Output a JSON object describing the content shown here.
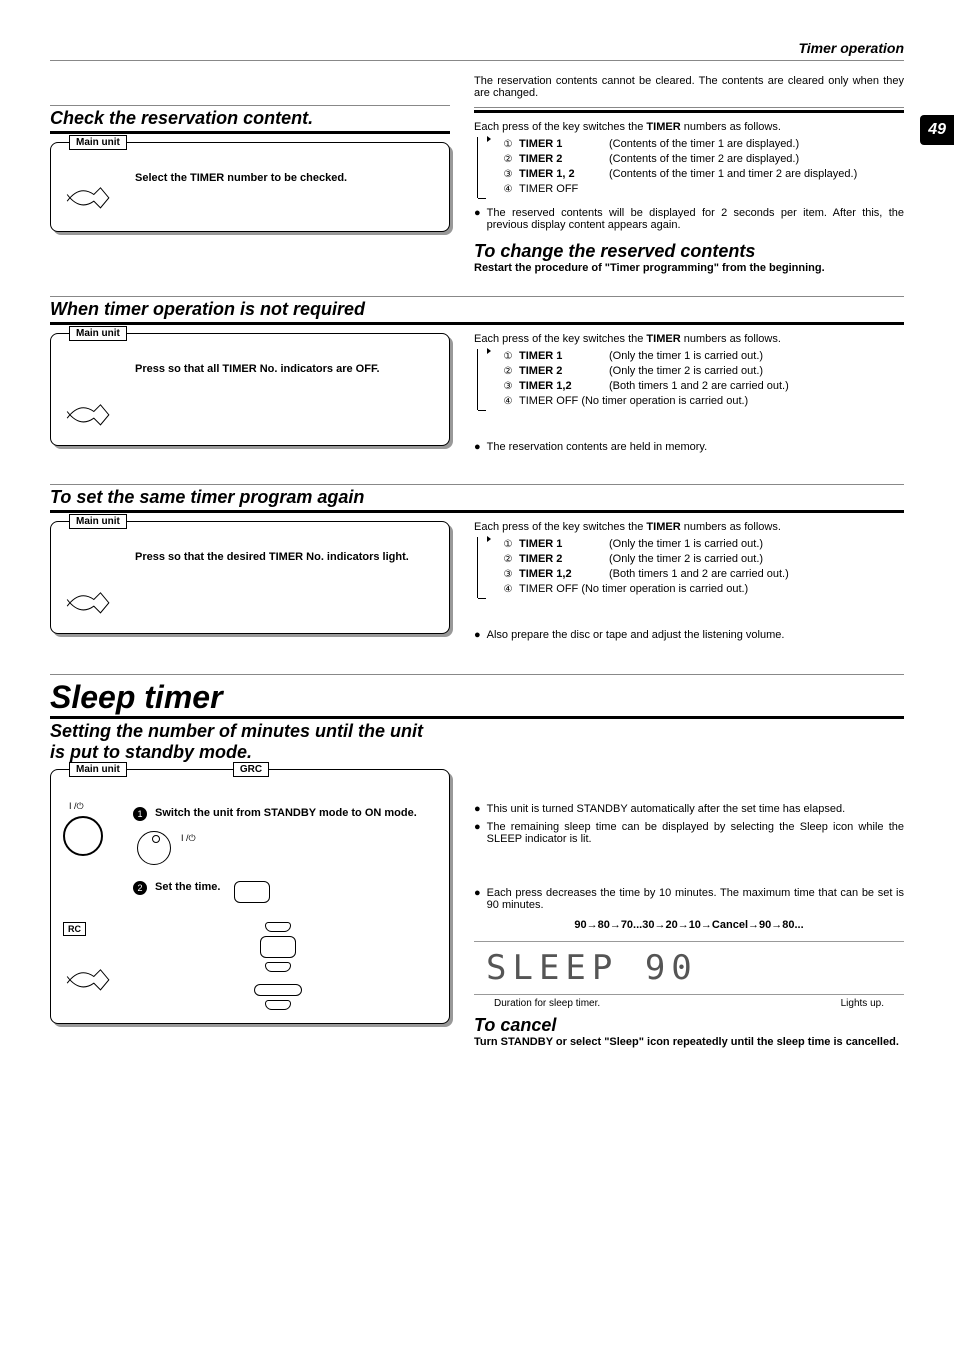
{
  "header": {
    "breadcrumb": "Timer operation",
    "page_number": "49"
  },
  "section1": {
    "title": "Check the reservation content.",
    "box_label": "Main unit",
    "step_text": "Select the TIMER number to be checked.",
    "intro": "The reservation contents cannot be cleared. The contents are cleared only when they are changed.",
    "each_press": "Each press of the key switches the ",
    "each_press_bold": "TIMER",
    "each_press_tail": " numbers as follows.",
    "list": [
      {
        "n": "①",
        "b": "TIMER 1",
        "t": "(Contents of the timer 1 are displayed.)"
      },
      {
        "n": "②",
        "b": "TIMER 2",
        "t": "(Contents of the timer 2 are displayed.)"
      },
      {
        "n": "③",
        "b": "TIMER 1, 2",
        "t": "(Contents of the timer 1 and timer 2 are displayed.)"
      },
      {
        "n": "④",
        "b": "",
        "t": "TIMER OFF"
      }
    ],
    "note": "The reserved contents will be displayed for 2 seconds per item. After this, the previous display content appears again.",
    "subheading": "To change the reserved contents",
    "subtext": "Restart the procedure of \"Timer programming\" from the beginning."
  },
  "section2": {
    "title": "When timer operation is not required",
    "box_label": "Main unit",
    "step_text": "Press so that all TIMER No. indicators are OFF.",
    "list": [
      {
        "n": "①",
        "b": "TIMER 1",
        "t": "(Only the timer 1 is carried out.)"
      },
      {
        "n": "②",
        "b": "TIMER 2",
        "t": "(Only the timer 2 is carried out.)"
      },
      {
        "n": "③",
        "b": "TIMER 1,2",
        "t": "(Both timers 1 and 2 are carried out.)"
      },
      {
        "n": "④",
        "b": "",
        "t": "TIMER OFF  (No timer operation is carried out.)"
      }
    ],
    "note": "The reservation contents are held in memory."
  },
  "section3": {
    "title": "To set the same timer program again",
    "box_label": "Main unit",
    "step_text": "Press so that the desired TIMER No. indicators light.",
    "list": [
      {
        "n": "①",
        "b": "TIMER 1",
        "t": "(Only the timer 1 is carried out.)"
      },
      {
        "n": "②",
        "b": "TIMER 2",
        "t": "(Only the timer 2 is carried out.)"
      },
      {
        "n": "③",
        "b": "TIMER 1,2",
        "t": "(Both timers 1 and 2 are carried out.)"
      },
      {
        "n": "④",
        "b": "",
        "t": "TIMER OFF  (No timer operation is carried out.)"
      }
    ],
    "note": "Also prepare the disc or tape and adjust the listening volume."
  },
  "sleep": {
    "title": "Sleep timer",
    "subtitle1": "Setting the number of minutes until the unit",
    "subtitle2": "is put to standby mode.",
    "box_label1": "Main unit",
    "box_label2": "GRC",
    "box_label3": "RC",
    "step1": "Switch the unit from STANDBY mode to ON mode.",
    "step2": "Set the time.",
    "power_label": "I /⏻",
    "power_label2": "I /⏻",
    "bullet1": "This unit is turned STANDBY automatically after the set time has elapsed.",
    "bullet2": "The remaining sleep time can be displayed by selecting the Sleep icon while the SLEEP indicator is lit.",
    "bullet3": "Each press decreases the time by 10 minutes. The maximum time that can be set is 90 minutes.",
    "seq": "90→80→70...30→20→10→Cancel→90→80...",
    "lcd": "SLEEP  90",
    "lcd_cap1": "Duration for sleep timer.",
    "lcd_cap2": "Lights up.",
    "cancel_heading": "To cancel",
    "cancel_text": "Turn STANDBY or select \"Sleep\" icon repeatedly until the sleep time is cancelled."
  }
}
